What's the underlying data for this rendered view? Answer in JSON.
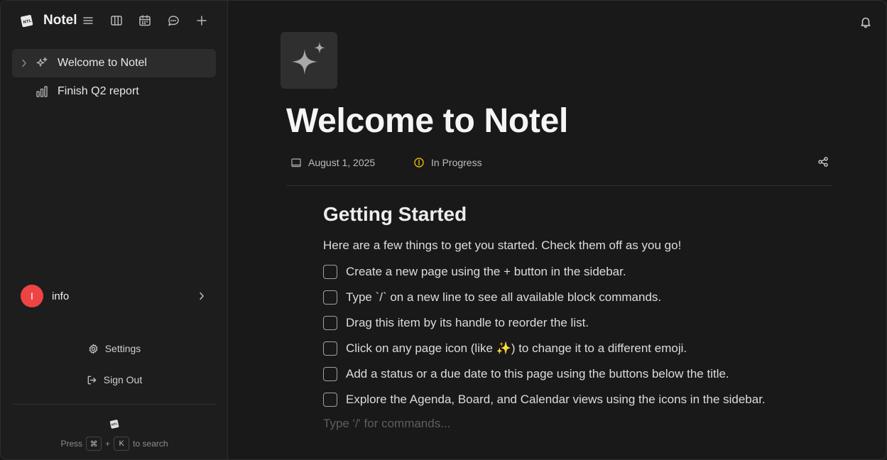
{
  "app": {
    "name": "Notel",
    "logo_text": "NTL"
  },
  "toolbar": {
    "icons": [
      "menu-icon",
      "columns-icon",
      "calendar-icon",
      "chat-icon",
      "plus-icon"
    ]
  },
  "sidebar": {
    "items": [
      {
        "label": "Welcome to Notel",
        "icon": "sparkles-icon",
        "active": true
      },
      {
        "label": "Finish Q2 report",
        "icon": "bar-chart-icon",
        "active": false
      }
    ],
    "user": {
      "initial": "I",
      "name": "info",
      "avatar_color": "#ef4444"
    },
    "settings_label": "Settings",
    "signout_label": "Sign Out",
    "search_hint": {
      "press": "Press",
      "key1": "⌘",
      "plus": "+",
      "key2": "K",
      "suffix": "to search"
    }
  },
  "page": {
    "title": "Welcome to Notel",
    "date": "August 1, 2025",
    "status": "In Progress",
    "status_color": "#eab308",
    "heading": "Getting Started",
    "intro": "Here are a few things to get you started. Check them off as you go!",
    "todos": [
      {
        "text": "Create a new page using the + button in the sidebar.",
        "checked": false
      },
      {
        "text": "Type `/` on a new line to see all available block commands.",
        "checked": false
      },
      {
        "text": "Drag this item by its handle to reorder the list.",
        "checked": false
      },
      {
        "text": "Click on any page icon (like ✨) to change it to a different emoji.",
        "checked": false
      },
      {
        "text": "Add a status or a due date to this page using the buttons below the title.",
        "checked": false
      },
      {
        "text": "Explore the Agenda, Board, and Calendar views using the icons in the sidebar.",
        "checked": false
      }
    ],
    "command_placeholder": "Type '/' for commands..."
  }
}
